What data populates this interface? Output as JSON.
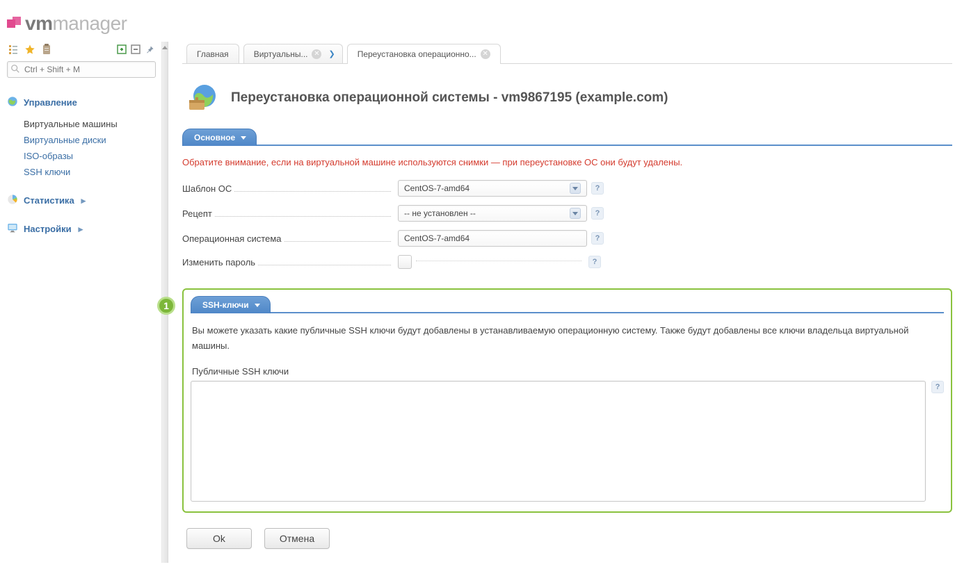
{
  "logo": {
    "bold": "vm",
    "light": "manager"
  },
  "toolbar": {
    "search_placeholder": "Ctrl + Shift + M"
  },
  "sidebar": {
    "sections": [
      {
        "label": "Управление",
        "items": [
          {
            "label": "Виртуальные машины",
            "active": true
          },
          {
            "label": "Виртуальные диски"
          },
          {
            "label": "ISO-образы"
          },
          {
            "label": "SSH ключи"
          }
        ]
      },
      {
        "label": "Статистика"
      },
      {
        "label": "Настройки"
      }
    ]
  },
  "tabs": [
    {
      "label": "Главная",
      "closable": false
    },
    {
      "label": "Виртуальны...",
      "closable": true,
      "arrow": true
    },
    {
      "label": "Переустановка операционно...",
      "closable": true,
      "active": true
    }
  ],
  "page": {
    "title": "Переустановка операционной системы - vm9867195 (example.com)",
    "section1": {
      "pill": "Основное",
      "warning": "Обратите внимание, если на виртуальной машине используются снимки — при переустановке ОС они будут удалены.",
      "rows": {
        "os_template_label": "Шаблон ОС",
        "os_template_value": "CentOS-7-amd64",
        "recipe_label": "Рецепт",
        "recipe_value": "-- не установлен --",
        "os_label": "Операционная система",
        "os_value": "CentOS-7-amd64",
        "change_pw_label": "Изменить пароль"
      }
    },
    "section2": {
      "pill": "SSH-ключи",
      "badge": "1",
      "desc": "Вы можете указать какие публичные SSH ключи будут добавлены в устанавливаемую операционную систему. Также будут добавлены все ключи владельца виртуальной машины.",
      "textarea_label": "Публичные SSH ключи"
    },
    "actions": {
      "ok": "Ok",
      "cancel": "Отмена"
    }
  }
}
